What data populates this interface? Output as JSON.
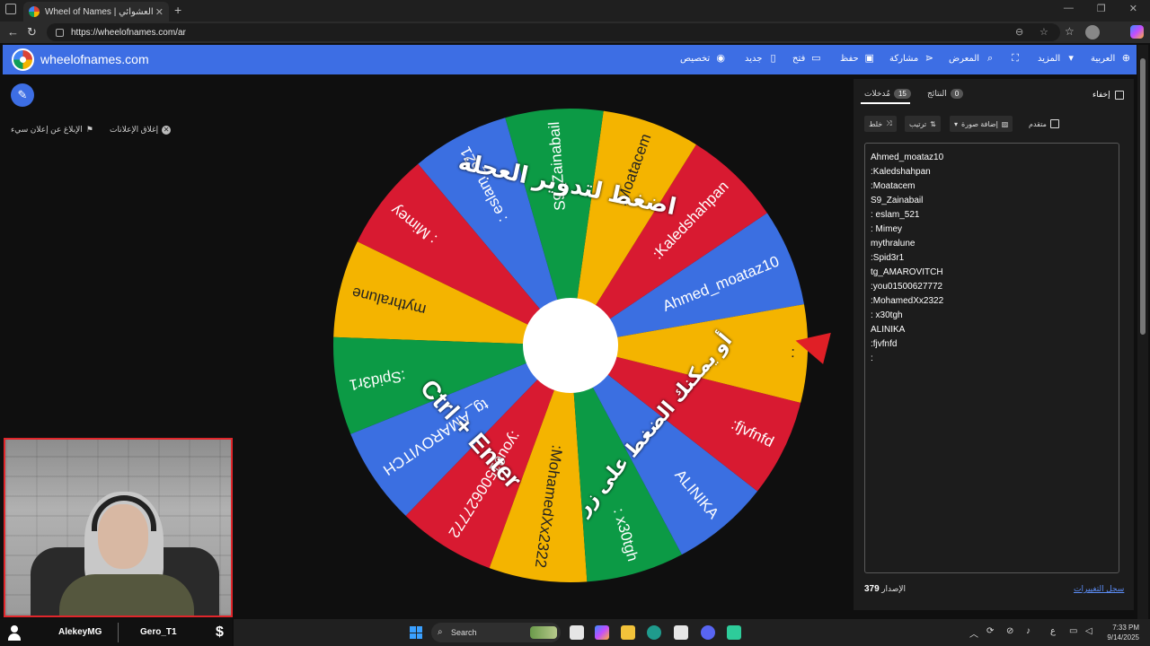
{
  "browser": {
    "tab_title": "Wheel of Names | الاسم العشوائي",
    "url": "https://wheelofnames.com/ar"
  },
  "site": {
    "name": "wheelofnames.com",
    "menu": [
      {
        "label": "تخصيص",
        "icon": "palette-icon"
      },
      {
        "label": "جديد",
        "icon": "new-file-icon"
      },
      {
        "label": "فتح",
        "icon": "folder-icon"
      },
      {
        "label": "حفظ",
        "icon": "save-icon"
      },
      {
        "label": "مشاركة",
        "icon": "share-icon"
      },
      {
        "label": "المعرض",
        "icon": "search-icon"
      },
      {
        "label": "",
        "icon": "fullscreen-icon"
      },
      {
        "label": "المزيد",
        "icon": "caret-down-icon"
      },
      {
        "label": "العربية",
        "icon": "globe-icon"
      }
    ]
  },
  "left": {
    "close_ads": "إغلاق الإعلانات",
    "report_ad": "الإبلاغ عن إعلان سيء"
  },
  "wheel": {
    "colors": {
      "green": "#0c9a45",
      "yellow": "#f4b400",
      "red": "#d81a31",
      "blue": "#3b6fe1"
    },
    "slices": [
      {
        "label": "Ahmed_moataz10",
        "color": "blue"
      },
      {
        "label": ":Kaledshahpan",
        "color": "red"
      },
      {
        "label": ":Moatacem",
        "color": "yellow"
      },
      {
        "label": "S9_Zainabail",
        "color": "green"
      },
      {
        "label": ": eslam_521",
        "color": "blue"
      },
      {
        "label": ": Mimey",
        "color": "red"
      },
      {
        "label": "mythralune",
        "color": "yellow"
      },
      {
        "label": ":Spid3r1",
        "color": "green"
      },
      {
        "label": "tg_AMAROVITCH",
        "color": "blue"
      },
      {
        "label": ":you01500627772",
        "color": "red"
      },
      {
        "label": ":MohamedXx2322",
        "color": "yellow"
      },
      {
        "label": ": x30tgh",
        "color": "green"
      },
      {
        "label": "ALINIKA",
        "color": "blue"
      },
      {
        "label": ":fjvfnfd",
        "color": "red"
      },
      {
        "label": ":",
        "color": "yellow"
      }
    ],
    "overlay_top": "اضغط لتدوير العجلة",
    "overlay_side": "أو يمكنك الضغط على زر",
    "overlay_keys": "Ctrl + Enter"
  },
  "panel": {
    "hide_label": "إخفاء",
    "tab_results": {
      "label": "النتائج",
      "count": "0"
    },
    "tab_entries": {
      "label": "مُدخلات",
      "count": "15"
    },
    "toolbar": {
      "shuffle": "خلط",
      "sort": "ترتيب",
      "add_image": "إضافة صورة",
      "advanced": "متقدم"
    },
    "entries": [
      "Ahmed_moataz10",
      ":Kaledshahpan",
      ":Moatacem",
      "S9_Zainabail",
      ": eslam_521",
      ": Mimey",
      "mythralune",
      ":Spid3r1",
      "tg_AMAROVITCH",
      ":you01500627772",
      ":MohamedXx2322",
      ": x30tgh",
      "ALINIKA",
      ":fjvfnfd",
      ":"
    ],
    "version_label": "الإصدار",
    "version": "379",
    "changelog": "سجل التغييرات"
  },
  "stream": {
    "name_left": "AlekeyMG",
    "name_right": "Gero_T1",
    "dollar": "$"
  },
  "taskbar": {
    "search": "Search",
    "tray_lang": "ع",
    "time": "7:33 PM",
    "date": "9/14/2025"
  }
}
